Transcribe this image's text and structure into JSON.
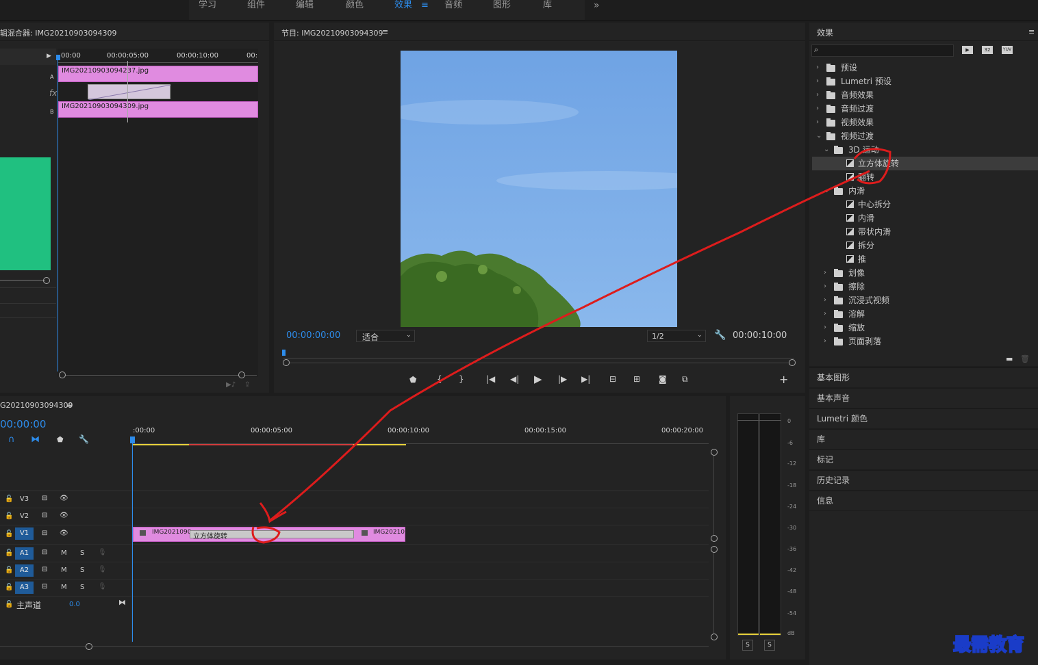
{
  "workspace_tabs": [
    "学习",
    "组件",
    "编辑",
    "颜色",
    "效果",
    "音频",
    "图形",
    "库"
  ],
  "workspace_active": "效果",
  "workspace_active_menu": "≡",
  "workspace_overflow": "»",
  "effect_controls": {
    "title": "辑混合器: IMG20210903094309",
    "ruler": [
      "00:00",
      "00:00:05:00",
      "00:00:10:00",
      "00:"
    ],
    "clip_a": "IMG20210903094237.jpg",
    "clip_b": "IMG20210903094309.jpg",
    "label_a": "A",
    "label_b": "B",
    "fx_label": "fx"
  },
  "program": {
    "title": "节目: IMG20210903094309",
    "menu": "≡",
    "timecode": "00:00:00:00",
    "zoom": "适合",
    "resolution": "1/2",
    "duration": "00:00:10:00",
    "add": "+"
  },
  "effects_panel": {
    "title": "效果",
    "menu": "≡",
    "search_placeholder": "",
    "filter_badges": [
      "32",
      "YUV"
    ],
    "tree": [
      {
        "label": "预设",
        "level": 0,
        "kind": "folder-special",
        "open": false
      },
      {
        "label": "Lumetri 预设",
        "level": 0,
        "kind": "folder-special",
        "open": false
      },
      {
        "label": "音频效果",
        "level": 0,
        "kind": "folder",
        "open": false
      },
      {
        "label": "音频过渡",
        "level": 0,
        "kind": "folder",
        "open": false
      },
      {
        "label": "视频效果",
        "level": 0,
        "kind": "folder",
        "open": false
      },
      {
        "label": "视频过渡",
        "level": 0,
        "kind": "folder",
        "open": true
      },
      {
        "label": "3D 运动",
        "level": 1,
        "kind": "folder",
        "open": true
      },
      {
        "label": "立方体旋转",
        "level": 2,
        "kind": "fx",
        "selected": true
      },
      {
        "label": "翻转",
        "level": 2,
        "kind": "fx"
      },
      {
        "label": "内滑",
        "level": 1,
        "kind": "folder",
        "open": true
      },
      {
        "label": "中心拆分",
        "level": 2,
        "kind": "fx"
      },
      {
        "label": "内滑",
        "level": 2,
        "kind": "fx"
      },
      {
        "label": "带状内滑",
        "level": 2,
        "kind": "fx"
      },
      {
        "label": "拆分",
        "level": 2,
        "kind": "fx"
      },
      {
        "label": "推",
        "level": 2,
        "kind": "fx"
      },
      {
        "label": "划像",
        "level": 1,
        "kind": "folder",
        "open": false
      },
      {
        "label": "擦除",
        "level": 1,
        "kind": "folder",
        "open": false
      },
      {
        "label": "沉浸式视频",
        "level": 1,
        "kind": "folder",
        "open": false
      },
      {
        "label": "溶解",
        "level": 1,
        "kind": "folder",
        "open": false
      },
      {
        "label": "缩放",
        "level": 1,
        "kind": "folder",
        "open": false
      },
      {
        "label": "页面剥落",
        "level": 1,
        "kind": "folder",
        "open": false
      }
    ]
  },
  "side_tabs": [
    "基本图形",
    "基本声音",
    "Lumetri 颜色",
    "库",
    "标记",
    "历史记录",
    "信息"
  ],
  "timeline": {
    "title": "G20210903094309",
    "menu": "≡",
    "timecode": "00:00:00",
    "ruler": [
      ":00:00",
      "00:00:05:00",
      "00:00:10:00",
      "00:00:15:00",
      "00:00:20:00"
    ],
    "video_tracks": [
      {
        "name": "V3",
        "active": false
      },
      {
        "name": "V2",
        "active": false
      },
      {
        "name": "V1",
        "active": true
      }
    ],
    "audio_tracks": [
      {
        "name": "A1",
        "m": "M",
        "s": "S"
      },
      {
        "name": "A2",
        "m": "M",
        "s": "S"
      },
      {
        "name": "A3",
        "m": "M",
        "s": "S"
      }
    ],
    "master_label": "主声道",
    "master_value": "0.0",
    "clip_left": "IMG2021090",
    "transition": "立方体旋转",
    "clip_right": "IMG20210"
  },
  "audio_meter": {
    "scale": [
      "0",
      "-6",
      "-12",
      "-18",
      "-24",
      "-30",
      "-36",
      "-42",
      "-48",
      "-54",
      "dB"
    ],
    "solo": [
      "S",
      "S"
    ]
  },
  "watermark": "最需教育"
}
